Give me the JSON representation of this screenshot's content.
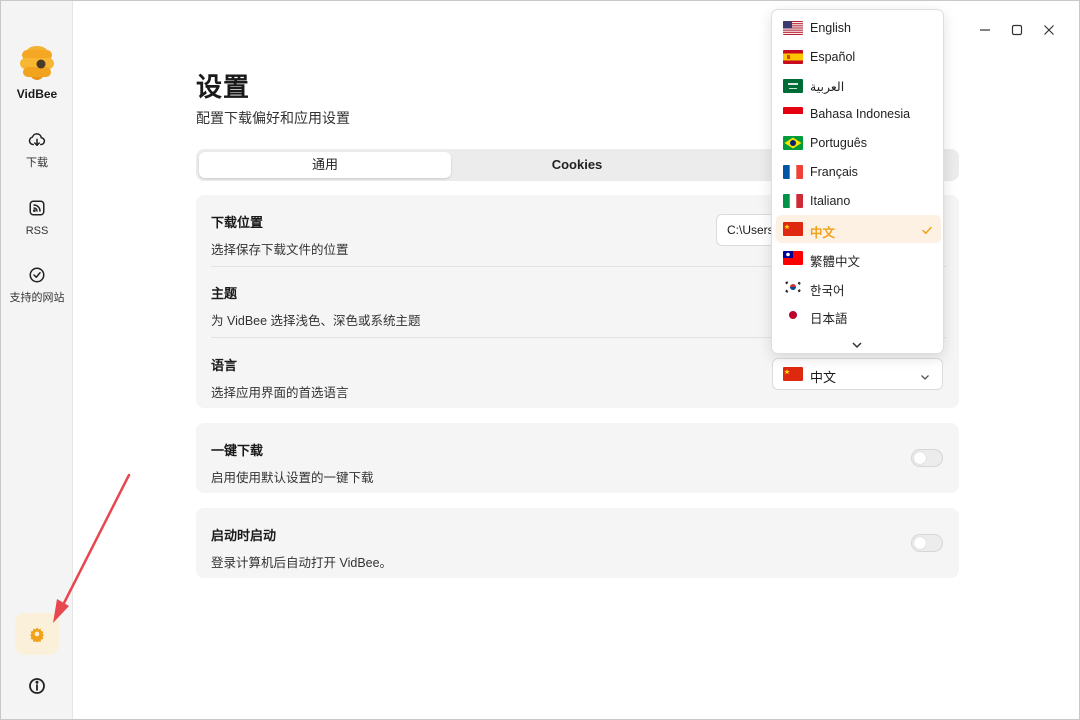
{
  "app": {
    "name": "VidBee"
  },
  "sidebar": {
    "items": [
      {
        "label": "下载",
        "icon": "download-icon"
      },
      {
        "label": "RSS",
        "icon": "rss-icon"
      },
      {
        "label": "支持的网站",
        "icon": "check-circle-icon"
      }
    ],
    "settings_icon": "gear-icon",
    "info_icon": "info-icon"
  },
  "window_controls": [
    "minimize-icon",
    "maximize-icon",
    "close-icon"
  ],
  "page": {
    "title": "设置",
    "subtitle": "配置下载偏好和应用设置"
  },
  "tabs": [
    {
      "label": "通用",
      "active": true
    },
    {
      "label": "Cookies",
      "active": false
    }
  ],
  "settings": {
    "download_location": {
      "title": "下载位置",
      "desc": "选择保存下载文件的位置",
      "value": "C:\\Users"
    },
    "theme": {
      "title": "主题",
      "desc": "为 VidBee 选择浅色、深色或系统主题"
    },
    "language": {
      "title": "语言",
      "desc": "选择应用界面的首选语言",
      "value": "中文"
    },
    "one_click": {
      "title": "一键下载",
      "desc": "启用使用默认设置的一键下载",
      "enabled": false
    },
    "launch_on_start": {
      "title": "启动时启动",
      "desc": "登录计算机后自动打开 VidBee。",
      "enabled": false
    }
  },
  "language_options": [
    {
      "label": "English",
      "flag": "us"
    },
    {
      "label": "Español",
      "flag": "es"
    },
    {
      "label": "العربية",
      "flag": "sa"
    },
    {
      "label": "Bahasa Indonesia",
      "flag": "id"
    },
    {
      "label": "Português",
      "flag": "br"
    },
    {
      "label": "Français",
      "flag": "fr"
    },
    {
      "label": "Italiano",
      "flag": "it"
    },
    {
      "label": "中文",
      "flag": "cn",
      "selected": true
    },
    {
      "label": "繁體中文",
      "flag": "tw"
    },
    {
      "label": "한국어",
      "flag": "kr"
    },
    {
      "label": "日本語",
      "flag": "jp"
    }
  ],
  "colors": {
    "accent": "#f0a21a",
    "selected_bg": "#fdf1e3",
    "card_bg": "#f5f5f5"
  }
}
